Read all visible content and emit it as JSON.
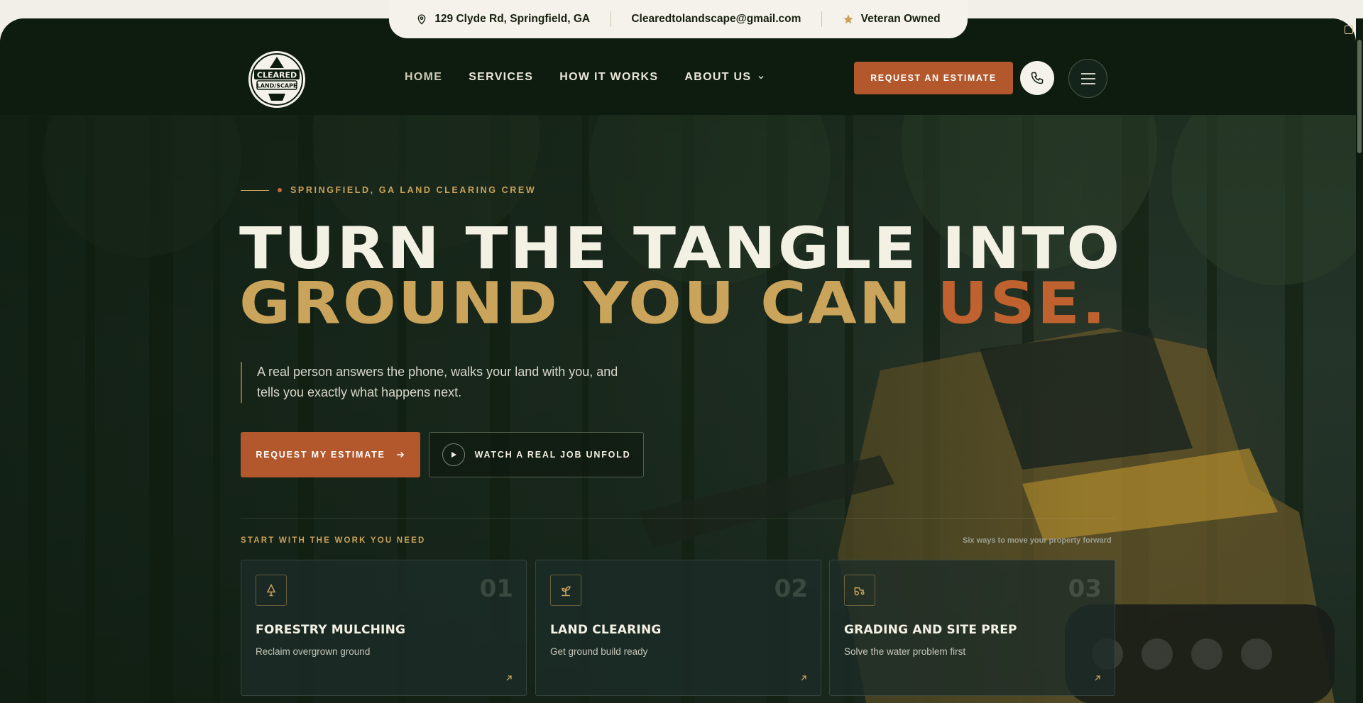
{
  "topbar": {
    "address": "129 Clyde Rd, Springfield, GA",
    "email": "Clearedtolandscape@gmail.com",
    "badge": "Veteran Owned"
  },
  "logo": {
    "line1": "CLEARED",
    "line2": "LAND/SCAPE"
  },
  "nav": {
    "items": [
      {
        "label": "HOME"
      },
      {
        "label": "SERVICES"
      },
      {
        "label": "HOW IT WORKS"
      },
      {
        "label": "ABOUT US"
      }
    ]
  },
  "header": {
    "cta": "REQUEST AN ESTIMATE"
  },
  "hero": {
    "eyebrow": "SPRINGFIELD, GA LAND CLEARING CREW",
    "headline_line1": "TURN THE TANGLE INTO",
    "headline_line2_a": "GROUND YOU CAN ",
    "headline_line2_b": "USE.",
    "lede": "A real person answers the phone, walks your land with you, and tells you exactly what happens next.",
    "primary_cta": "REQUEST MY ESTIMATE",
    "secondary_cta": "WATCH A REAL JOB UNFOLD"
  },
  "services": {
    "label": "START WITH THE WORK YOU NEED",
    "note": "Six ways to move your property forward",
    "cards": [
      {
        "num": "01",
        "title": "FORESTRY MULCHING",
        "subtitle": "Reclaim overgrown ground",
        "icon": "tree-icon"
      },
      {
        "num": "02",
        "title": "LAND CLEARING",
        "subtitle": "Get ground build ready",
        "icon": "sprout-icon"
      },
      {
        "num": "03",
        "title": "GRADING AND SITE PREP",
        "subtitle": "Solve the water problem first",
        "icon": "tractor-icon"
      }
    ]
  },
  "colors": {
    "accent_orange": "#b2582c",
    "accent_gold": "#c9a25c",
    "dark_green": "#0e1c0f",
    "cream": "#f4f2ea"
  }
}
